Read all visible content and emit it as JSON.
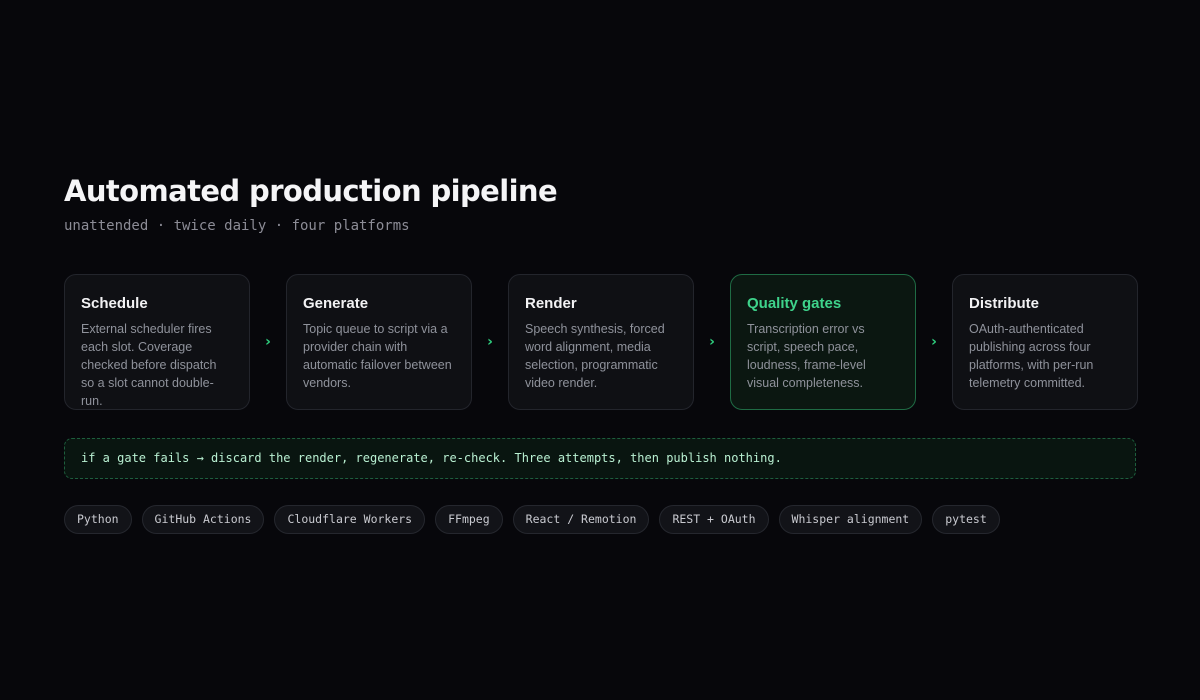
{
  "header": {
    "title": "Automated production pipeline",
    "subtitle": "unattended · twice daily · four platforms"
  },
  "stages": [
    {
      "title": "Schedule",
      "description": "External scheduler fires each slot. Coverage checked before dispatch so a slot cannot double-run.",
      "highlighted": false
    },
    {
      "title": "Generate",
      "description": "Topic queue to script via a provider chain with automatic failover between vendors.",
      "highlighted": false
    },
    {
      "title": "Render",
      "description": "Speech synthesis, forced word alignment, media selection, programmatic video render.",
      "highlighted": false
    },
    {
      "title": "Quality gates",
      "description": "Transcription error vs script, speech pace, loudness, frame-level visual completeness.",
      "highlighted": true
    },
    {
      "title": "Distribute",
      "description": "OAuth-authenticated publishing across four platforms, with per-run telemetry committed.",
      "highlighted": false
    }
  ],
  "arrow_icon": "chevron-right-icon",
  "note": "if a gate fails → discard the render, regenerate, re-check. Three attempts, then publish nothing.",
  "tags": [
    "Python",
    "GitHub Actions",
    "Cloudflare Workers",
    "FFmpeg",
    "React / Remotion",
    "REST + OAuth",
    "Whisper alignment",
    "pytest"
  ],
  "colors": {
    "background": "#07070b",
    "accent": "#3ed38b",
    "card": "#0f1014",
    "card_border": "#23252c"
  }
}
